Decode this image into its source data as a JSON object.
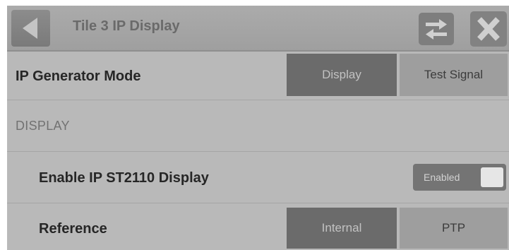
{
  "header": {
    "title": "Tile 3 IP Display",
    "back_icon": "back-arrow-icon",
    "swap_icon": "swap-arrows-icon",
    "close_icon": "close-x-icon"
  },
  "generator_mode": {
    "label": "IP Generator Mode",
    "options": [
      "Display",
      "Test Signal"
    ],
    "selected": "Display"
  },
  "display_section": {
    "heading": "DISPLAY"
  },
  "enable_display": {
    "label": "Enable IP ST2110 Display",
    "toggle_text": "Enabled",
    "enabled": true
  },
  "reference": {
    "label": "Reference",
    "options": [
      "Internal",
      "PTP"
    ],
    "selected": "Internal"
  },
  "colors": {
    "panel_background": "#b9b9b9",
    "header_background": "#a5a5a5",
    "segment_active": "#6b6b6b",
    "segment_inactive": "#9e9e9e"
  }
}
